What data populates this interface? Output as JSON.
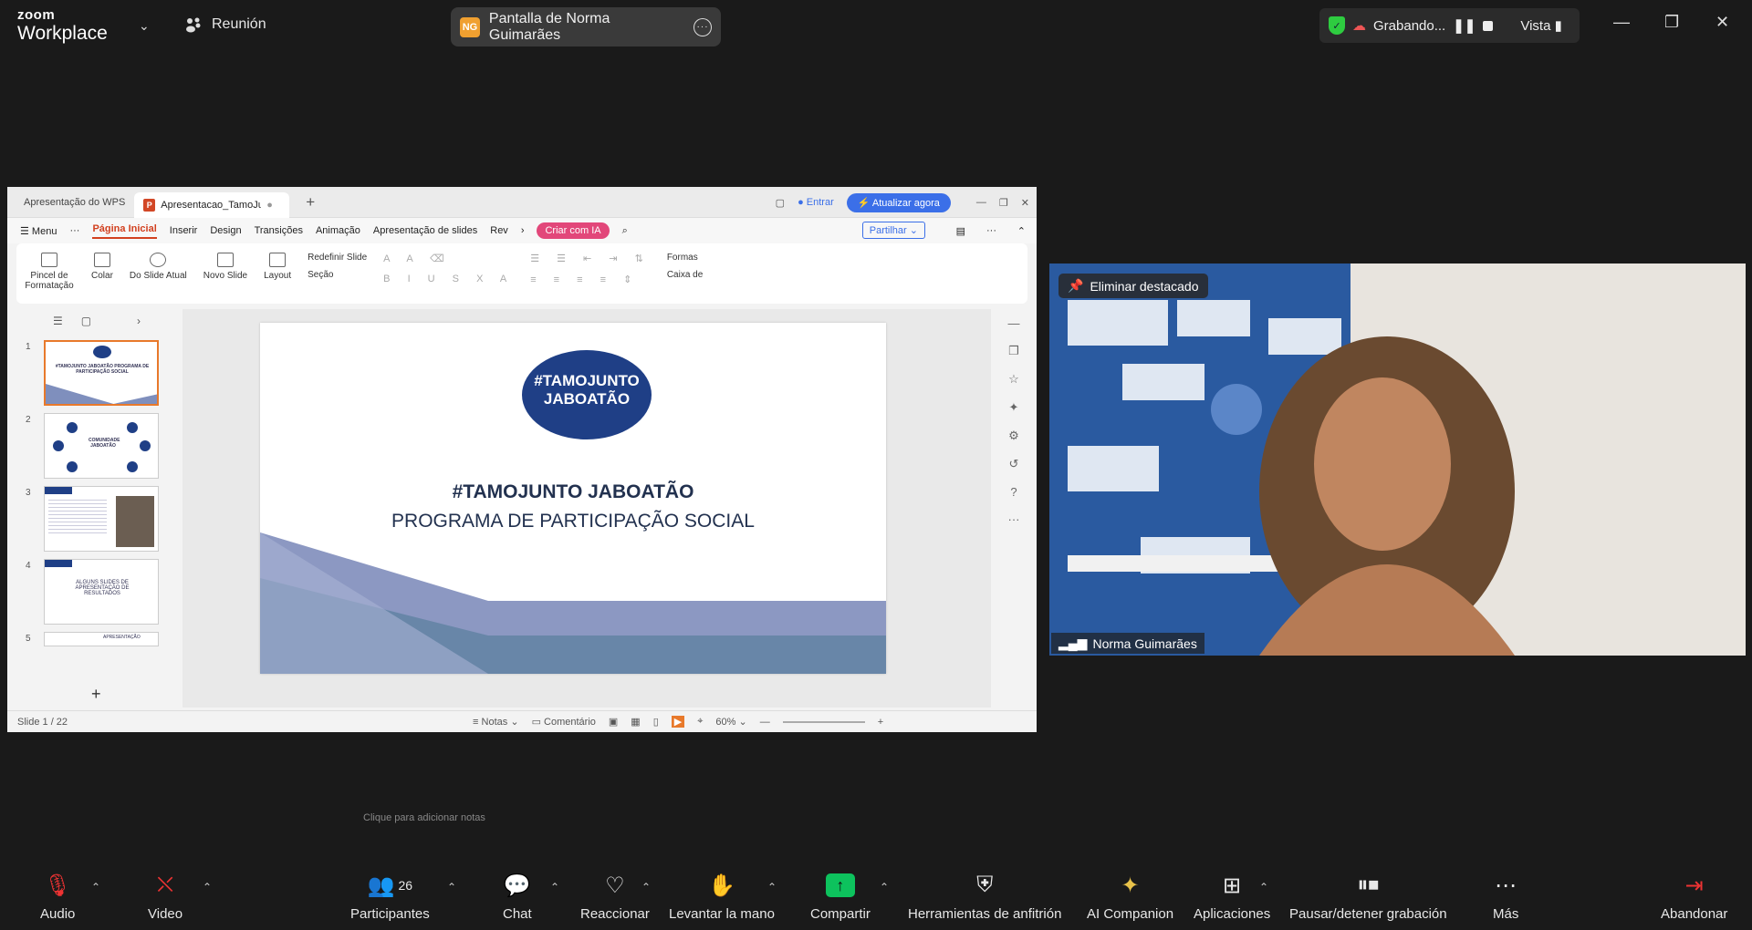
{
  "app": {
    "brand_top": "zoom",
    "brand_bottom": "Workplace"
  },
  "meeting_label": "Reunión",
  "screen_share": {
    "avatar": "NG",
    "label": "Pantalla de Norma Guimarães"
  },
  "recording": {
    "label": "Grabando...",
    "view_label": "Vista"
  },
  "wps": {
    "tabs": [
      "Apresentação do WPS",
      "Apresentacao_TamoJuntoJG_c"
    ],
    "login": "Entrar",
    "upgrade": "Atualizar agora",
    "menu": [
      "Menu",
      "Página Inicial",
      "Inserir",
      "Design",
      "Transições",
      "Animação",
      "Apresentação de slides",
      "Rev"
    ],
    "ai_button": "Criar com IA",
    "share": "Partilhar",
    "ribbon": {
      "format_painter": "Pincel de Formatação",
      "paste": "Colar",
      "from_current": "Do Slide Atual",
      "new_slide": "Novo Slide",
      "layout": "Layout",
      "reset_slide": "Redefinir Slide",
      "section": "Seção",
      "shapes": "Formas",
      "textbox": "Caixa de"
    },
    "thumbnails": [
      {
        "num": "1",
        "text": "#TAMOJUNTO JABOATÃO PROGRAMA DE PARTICIPAÇÃO SOCIAL"
      },
      {
        "num": "2",
        "text": "COMUNIDADE JABOATÃO"
      },
      {
        "num": "3",
        "text": ""
      },
      {
        "num": "4",
        "text": "ALGUNS SLIDES DE APRESENTAÇÃO DE RESULTADOS"
      },
      {
        "num": "5",
        "text": "APRESENTAÇÃO"
      }
    ],
    "slide": {
      "logo_line1": "#TAMOJUNTO",
      "logo_line2": "JABOATÃO",
      "title": "#TAMOJUNTO JABOATÃO",
      "subtitle": "PROGRAMA DE PARTICIPAÇÃO SOCIAL"
    },
    "notes_placeholder": "Clique para adicionar notas",
    "status": {
      "slide": "Slide 1 / 22",
      "notes": "Notas",
      "comment": "Comentário",
      "zoom": "60%"
    }
  },
  "video": {
    "pin_label": "Eliminar destacado",
    "name": "Norma Guimarães"
  },
  "toolbar": {
    "audio": "Audio",
    "video": "Video",
    "participants": "Participantes",
    "participants_count": "26",
    "chat": "Chat",
    "react": "Reaccionar",
    "raise_hand": "Levantar la mano",
    "share": "Compartir",
    "host_tools": "Herramientas de anfitrión",
    "ai": "AI Companion",
    "apps": "Aplicaciones",
    "record": "Pausar/detener grabación",
    "more": "Más",
    "leave": "Abandonar"
  },
  "colors": {
    "share_green": "#0dc25d",
    "wps_orange": "#d2401f",
    "slide_navy": "#1f3f86",
    "shield_green": "#2ecc40"
  }
}
